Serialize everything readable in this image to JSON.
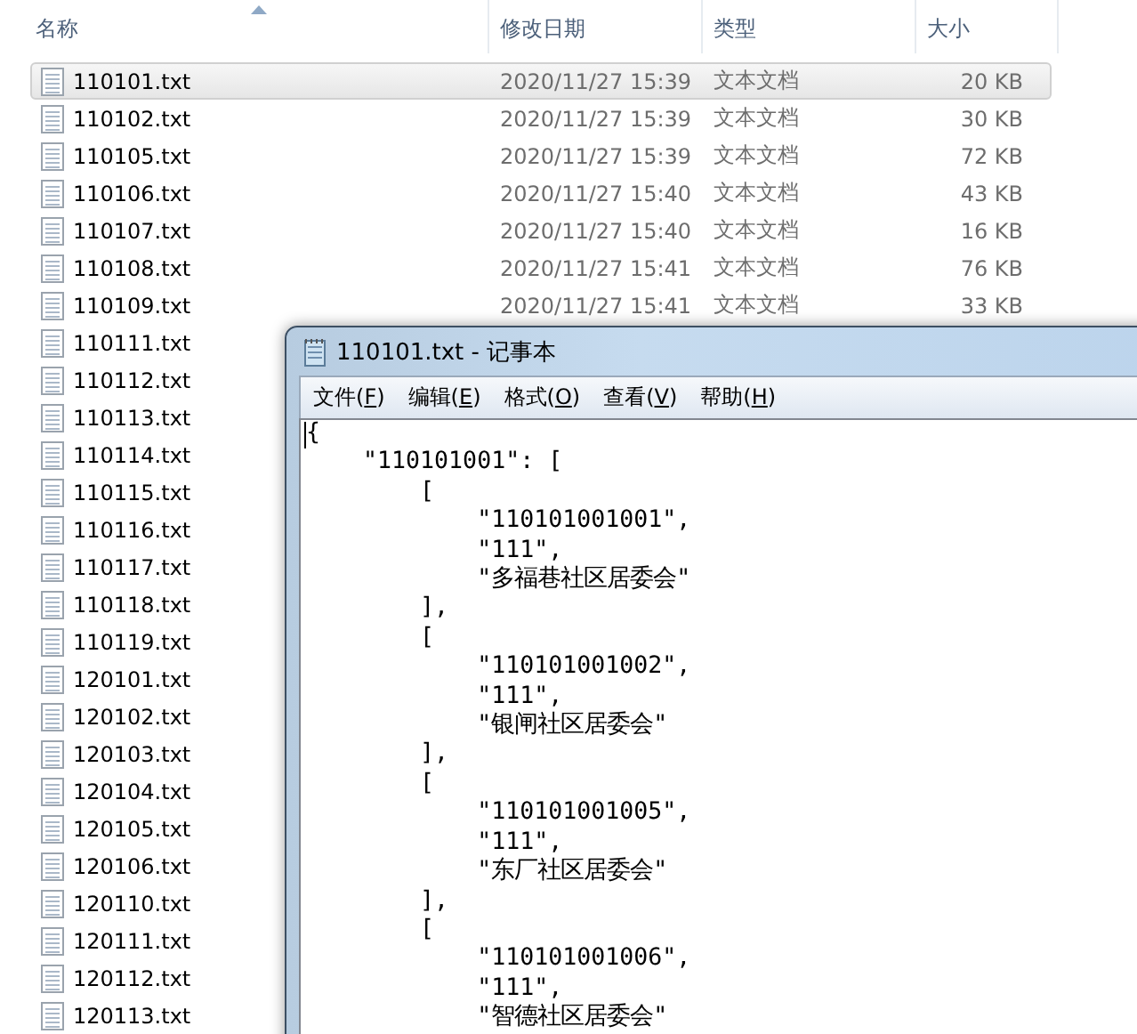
{
  "explorer": {
    "columns": [
      "名称",
      "修改日期",
      "类型",
      "大小"
    ],
    "rows": [
      {
        "name": "110101.txt",
        "date": "2020/11/27 15:39",
        "type": "文本文档",
        "size": "20 KB",
        "selected": true
      },
      {
        "name": "110102.txt",
        "date": "2020/11/27 15:39",
        "type": "文本文档",
        "size": "30 KB",
        "selected": false
      },
      {
        "name": "110105.txt",
        "date": "2020/11/27 15:39",
        "type": "文本文档",
        "size": "72 KB",
        "selected": false
      },
      {
        "name": "110106.txt",
        "date": "2020/11/27 15:40",
        "type": "文本文档",
        "size": "43 KB",
        "selected": false
      },
      {
        "name": "110107.txt",
        "date": "2020/11/27 15:40",
        "type": "文本文档",
        "size": "16 KB",
        "selected": false
      },
      {
        "name": "110108.txt",
        "date": "2020/11/27 15:41",
        "type": "文本文档",
        "size": "76 KB",
        "selected": false
      },
      {
        "name": "110109.txt",
        "date": "2020/11/27 15:41",
        "type": "文本文档",
        "size": "33 KB",
        "selected": false
      },
      {
        "name": "110111.txt",
        "selected": false
      },
      {
        "name": "110112.txt",
        "selected": false
      },
      {
        "name": "110113.txt",
        "selected": false
      },
      {
        "name": "110114.txt",
        "selected": false
      },
      {
        "name": "110115.txt",
        "selected": false
      },
      {
        "name": "110116.txt",
        "selected": false
      },
      {
        "name": "110117.txt",
        "selected": false
      },
      {
        "name": "110118.txt",
        "selected": false
      },
      {
        "name": "110119.txt",
        "selected": false
      },
      {
        "name": "120101.txt",
        "selected": false
      },
      {
        "name": "120102.txt",
        "selected": false
      },
      {
        "name": "120103.txt",
        "selected": false
      },
      {
        "name": "120104.txt",
        "selected": false
      },
      {
        "name": "120105.txt",
        "selected": false
      },
      {
        "name": "120106.txt",
        "selected": false
      },
      {
        "name": "120110.txt",
        "selected": false
      },
      {
        "name": "120111.txt",
        "selected": false
      },
      {
        "name": "120112.txt",
        "selected": false
      },
      {
        "name": "120113.txt",
        "selected": false
      }
    ]
  },
  "notepad": {
    "title": "110101.txt - 记事本",
    "menu": [
      {
        "label": "文件(",
        "key": "F",
        "end": ")"
      },
      {
        "label": "编辑(",
        "key": "E",
        "end": ")"
      },
      {
        "label": "格式(",
        "key": "O",
        "end": ")"
      },
      {
        "label": "查看(",
        "key": "V",
        "end": ")"
      },
      {
        "label": "帮助(",
        "key": "H",
        "end": ")"
      }
    ],
    "lines": [
      "{",
      "    \"110101001\": [",
      "        [",
      "            \"110101001001\",",
      "            \"111\",",
      "            \"多福巷社区居委会\"",
      "        ],",
      "        [",
      "            \"110101001002\",",
      "            \"111\",",
      "            \"银闸社区居委会\"",
      "        ],",
      "        [",
      "            \"110101001005\",",
      "            \"111\",",
      "            \"东厂社区居委会\"",
      "        ],",
      "        [",
      "            \"110101001006\",",
      "            \"111\",",
      "            \"智德社区居委会\""
    ]
  }
}
